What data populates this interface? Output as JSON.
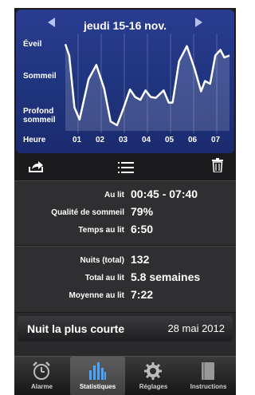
{
  "header": {
    "date_label": "jeudi 15-16 nov."
  },
  "chart_data": {
    "type": "area",
    "y_categories": [
      "Éveil",
      "Sommeil",
      "Profond sommeil"
    ],
    "x_label": "Heure",
    "x": [
      "01",
      "02",
      "03",
      "04",
      "05",
      "06",
      "07"
    ],
    "series": [
      {
        "values_description": "sleep depth curve",
        "points": [
          [
            0.0,
            0.92
          ],
          [
            0.15,
            0.8
          ],
          [
            0.35,
            0.25
          ],
          [
            0.55,
            0.12
          ],
          [
            0.9,
            0.55
          ],
          [
            1.2,
            0.7
          ],
          [
            1.5,
            0.45
          ],
          [
            1.75,
            0.1
          ],
          [
            2.0,
            0.06
          ],
          [
            2.25,
            0.24
          ],
          [
            2.5,
            0.44
          ],
          [
            2.7,
            0.36
          ],
          [
            2.9,
            0.33
          ],
          [
            3.1,
            0.43
          ],
          [
            3.3,
            0.36
          ],
          [
            3.5,
            0.35
          ],
          [
            3.8,
            0.43
          ],
          [
            4.0,
            0.3
          ],
          [
            4.15,
            0.3
          ],
          [
            4.4,
            0.74
          ],
          [
            4.7,
            0.9
          ],
          [
            5.0,
            0.66
          ],
          [
            5.25,
            0.42
          ],
          [
            5.4,
            0.53
          ],
          [
            5.6,
            0.5
          ],
          [
            5.8,
            0.8
          ],
          [
            6.0,
            0.86
          ],
          [
            6.15,
            0.78
          ],
          [
            6.35,
            0.8
          ]
        ],
        "color": "#ffffff"
      }
    ],
    "ylim": [
      0,
      1
    ],
    "xlim": [
      0,
      6.35
    ],
    "grid": true
  },
  "toolbar": {
    "share_icon": "share-icon",
    "list_icon": "list-icon",
    "delete_icon": "trash-icon"
  },
  "stats": {
    "rows": [
      {
        "label": "Au lit",
        "value": "00:45 - 07:40"
      },
      {
        "label": "Qualité de sommeil",
        "value": "79%"
      },
      {
        "label": "Temps au lit",
        "value": "6:50"
      }
    ]
  },
  "totals": {
    "rows": [
      {
        "label": "Nuits (total)",
        "value": "132"
      },
      {
        "label": "Total au lit",
        "value": "5.8 semaines"
      },
      {
        "label": "Moyenne au lit",
        "value": "7:22"
      }
    ]
  },
  "banner": {
    "left": "Nuit la plus courte",
    "right": "28 mai 2012"
  },
  "tabs": [
    {
      "label": "Alarme",
      "icon": "alarm-clock-icon",
      "active": false
    },
    {
      "label": "Statistiques",
      "icon": "bar-chart-icon",
      "active": true
    },
    {
      "label": "Réglages",
      "icon": "gear-icon",
      "active": false
    },
    {
      "label": "Instructions",
      "icon": "book-icon",
      "active": false
    }
  ],
  "colors": {
    "chart_bg": "#2a3c90",
    "curve": "#ffffff",
    "app_bg": "#2a2a2c"
  }
}
